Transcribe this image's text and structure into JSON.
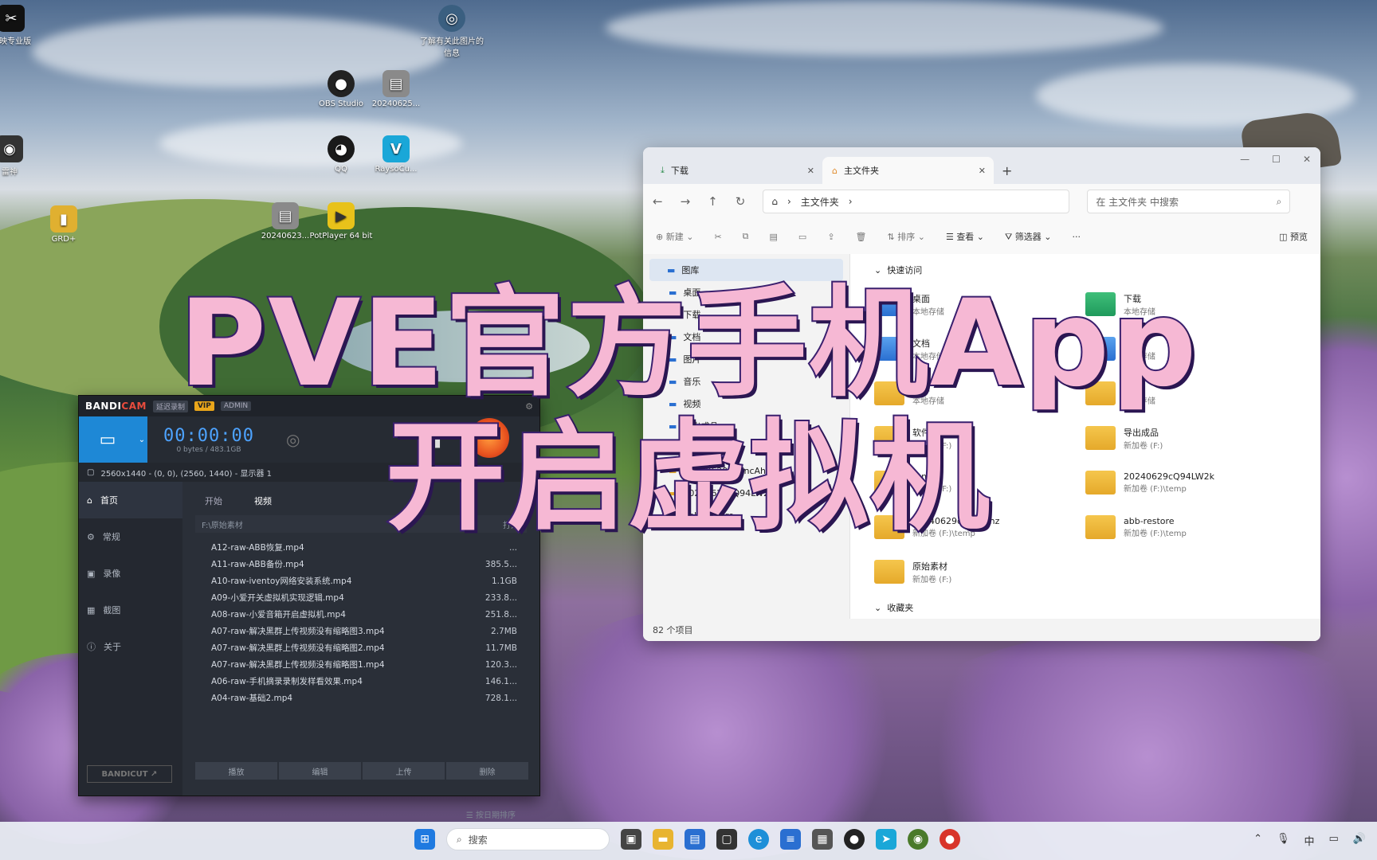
{
  "overlay": {
    "line1": "PVE官方手机App",
    "line2": "开启虚拟机"
  },
  "desktop_icons": [
    {
      "label": "剪映专业版",
      "glyph": "✂",
      "color": "#111111",
      "icon": "capcut-icon"
    },
    {
      "label": "了解有关此图片的信息",
      "glyph": "◎",
      "color": "#3a5f80",
      "icon": "spotlight-icon"
    },
    {
      "label": "OBS Studio",
      "glyph": "●",
      "color": "#222222",
      "icon": "obs-icon"
    },
    {
      "label": "20240625...",
      "glyph": "▤",
      "color": "#8a8a8a",
      "icon": "image-file-icon"
    },
    {
      "label": "雷神",
      "glyph": "◉",
      "color": "#333333",
      "icon": "app-icon"
    },
    {
      "label": "QQ",
      "glyph": "◕",
      "color": "#1a1a1a",
      "icon": "qq-icon"
    },
    {
      "label": "RaysoCu...",
      "glyph": "V",
      "color": "#1aa7d8",
      "icon": "rayso-icon"
    },
    {
      "label": "GRD+",
      "glyph": "▮",
      "color": "#e0b030",
      "icon": "folder-shortcut-icon"
    },
    {
      "label": "20240623...",
      "glyph": "▤",
      "color": "#8a8a8a",
      "icon": "image-file-icon"
    },
    {
      "label": "PotPlayer 64 bit",
      "glyph": "▶",
      "color": "#e8c21a",
      "icon": "potplayer-icon"
    }
  ],
  "explorer": {
    "tab1": "下载",
    "tab2": "主文件夹",
    "address": "主文件夹",
    "search_placeholder": "在 主文件夹 中搜索",
    "cmd": {
      "new": "新建",
      "sort": "排序",
      "view": "查看",
      "filter": "筛选器",
      "details": "预览"
    },
    "sidebar": [
      {
        "label": "图库",
        "sel": true
      },
      {
        "label": "桌面"
      },
      {
        "label": "下载"
      },
      {
        "label": "文档"
      },
      {
        "label": "图片"
      },
      {
        "label": "音乐"
      },
      {
        "label": "视频"
      },
      {
        "label": "导出成品"
      },
      {
        "label": "原始素材"
      },
      {
        "label": "20240629qPYncAhz"
      },
      {
        "label": "20240629cQ94LW2k"
      },
      {
        "label": "abb-restore"
      }
    ],
    "quick_access": "快速访问",
    "favorites": "收藏夹",
    "items": [
      {
        "name": "桌面",
        "sub": "本地存储",
        "kind": "blue"
      },
      {
        "name": "下载",
        "sub": "本地存储",
        "kind": "green"
      },
      {
        "name": "文档",
        "sub": "本地存储",
        "kind": "blue"
      },
      {
        "name": "图片",
        "sub": "本地存储",
        "kind": "blue"
      },
      {
        "name": "音乐",
        "sub": "本地存储",
        "kind": "yellow"
      },
      {
        "name": "视频",
        "sub": "本地存储",
        "kind": "yellow"
      },
      {
        "name": "软件",
        "sub": "新加卷 (F:)",
        "kind": "yellow"
      },
      {
        "name": "导出成品",
        "sub": "新加卷 (F:)",
        "kind": "yellow"
      },
      {
        "name": "temp",
        "sub": "新加卷 (F:)",
        "kind": "yellow"
      },
      {
        "name": "20240629cQ94LW2k",
        "sub": "新加卷 (F:)\\temp",
        "kind": "yellow"
      },
      {
        "name": "20240629qPYncAhz",
        "sub": "新加卷 (F:)\\temp",
        "kind": "yellow"
      },
      {
        "name": "abb-restore",
        "sub": "新加卷 (F:)\\temp",
        "kind": "yellow"
      },
      {
        "name": "原始素材",
        "sub": "新加卷 (F:)",
        "kind": "yellow"
      }
    ],
    "status": "82 个项目"
  },
  "bandicam": {
    "logo_a": "BANDI",
    "logo_b": "CAM",
    "mode": "延迟录制",
    "vip": "VIP",
    "admin": "ADMIN",
    "timer": "00:00:00",
    "size": "0 bytes / 483.1GB",
    "resolution": "2560x1440 - (0, 0), (2560, 1440) - 显示器 1",
    "side": [
      {
        "label": "首页",
        "sel": true,
        "icon": "home-icon",
        "glyph": "⌂"
      },
      {
        "label": "常规",
        "icon": "gear-icon",
        "glyph": "⚙"
      },
      {
        "label": "录像",
        "icon": "video-icon",
        "glyph": "▣"
      },
      {
        "label": "截图",
        "icon": "image-icon",
        "glyph": "▦"
      },
      {
        "label": "关于",
        "icon": "info-icon",
        "glyph": "ⓘ"
      }
    ],
    "tab_start": "开始",
    "tab_video": "视频",
    "path": "F:\\原始素材",
    "path_btn": "打开",
    "files": [
      {
        "name": "A12-raw-ABB恢复.mp4",
        "size": "..."
      },
      {
        "name": "A11-raw-ABB备份.mp4",
        "size": "385.5..."
      },
      {
        "name": "A10-raw-iventoy网络安装系统.mp4",
        "size": "1.1GB"
      },
      {
        "name": "A09-小爱开关虚拟机实现逻辑.mp4",
        "size": "233.8..."
      },
      {
        "name": "A08-raw-小爱音箱开启虚拟机.mp4",
        "size": "251.8..."
      },
      {
        "name": "A07-raw-解决黑群上传视频没有缩略图3.mp4",
        "size": "2.7MB"
      },
      {
        "name": "A07-raw-解决黑群上传视频没有缩略图2.mp4",
        "size": "11.7MB"
      },
      {
        "name": "A07-raw-解决黑群上传视频没有缩略图1.mp4",
        "size": "120.3..."
      },
      {
        "name": "A06-raw-手机摘录录制发样看效果.mp4",
        "size": "146.1..."
      },
      {
        "name": "A04-raw-基础2.mp4",
        "size": "728.1..."
      }
    ],
    "sort": "按日期排序",
    "buttons": [
      "播放",
      "编辑",
      "上传",
      "删除"
    ],
    "bandicut": "BANDICUT ↗"
  },
  "taskbar": {
    "search": "搜索",
    "ime": "中"
  }
}
